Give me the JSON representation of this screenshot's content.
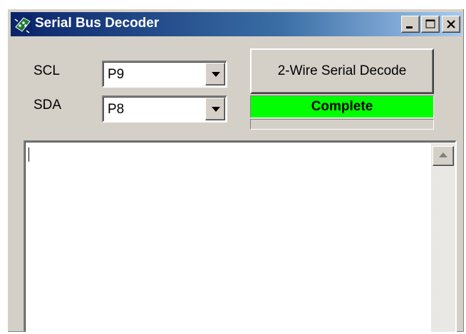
{
  "window": {
    "title": "Serial Bus Decoder",
    "app_icon": "circuit-board-icon"
  },
  "title_buttons": [
    {
      "name": "minimize",
      "icon": "minimize-icon"
    },
    {
      "name": "maximize",
      "icon": "maximize-icon"
    },
    {
      "name": "close",
      "icon": "close-icon"
    }
  ],
  "fields": {
    "scl": {
      "label": "SCL",
      "value": "P9"
    },
    "sda": {
      "label": "SDA",
      "value": "P8"
    }
  },
  "decode_button": {
    "label": "2-Wire Serial Decode"
  },
  "status": {
    "text": "Complete",
    "color": "#00ff00"
  },
  "output": {
    "text": ""
  },
  "colors": {
    "face": "#d4d0c8",
    "title_start": "#0a246a",
    "title_end": "#a6caf0"
  }
}
